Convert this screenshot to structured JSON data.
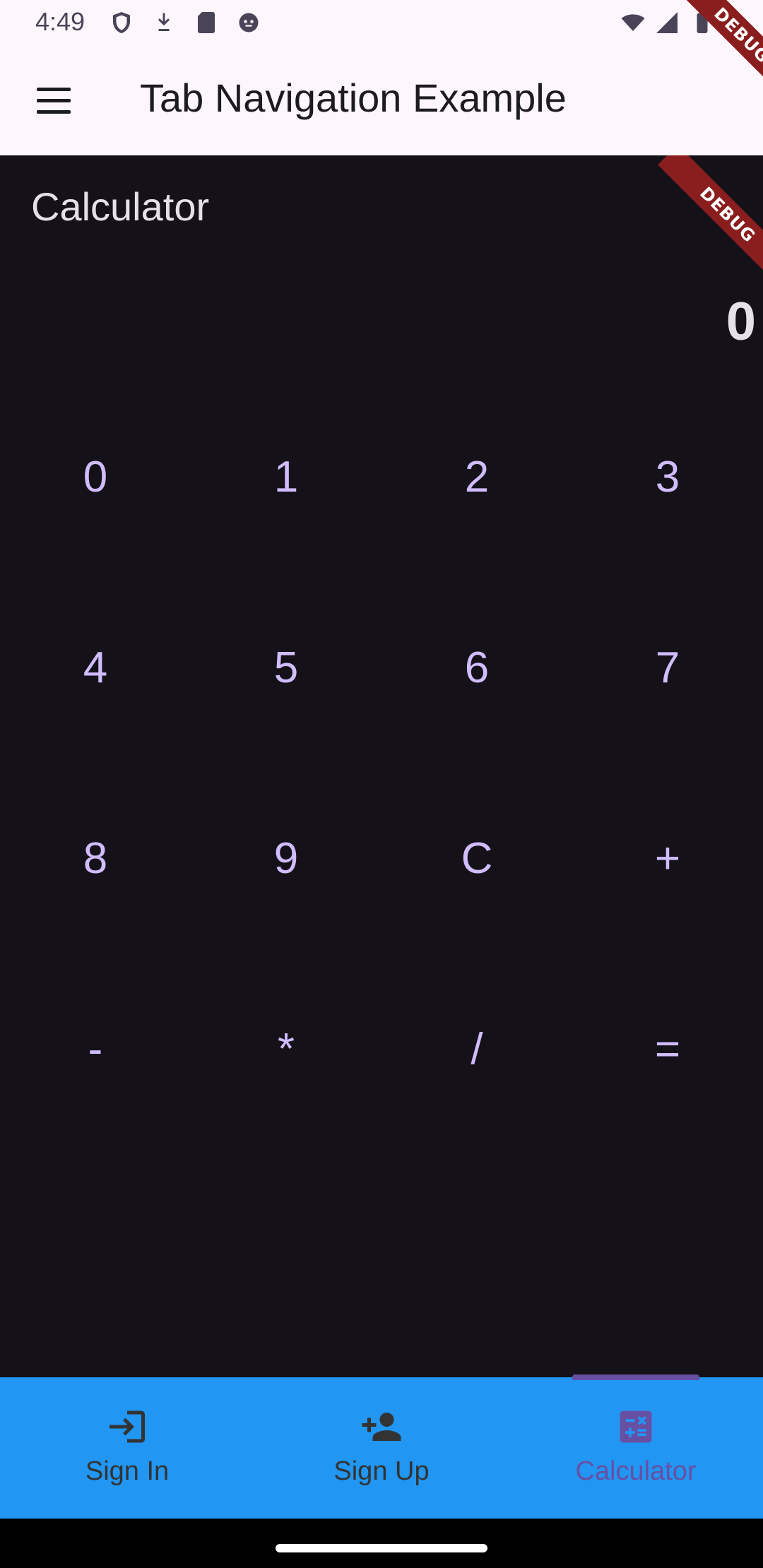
{
  "status_bar": {
    "time": "4:49",
    "icons": [
      "shield-icon",
      "download-icon",
      "sd-card-icon",
      "cat-face-icon",
      "wifi-icon",
      "signal-icon",
      "battery-icon"
    ]
  },
  "app_bar": {
    "title": "Tab Navigation Example",
    "menu_icon": "hamburger-menu-icon"
  },
  "debug_banner": "DEBUG",
  "calculator": {
    "title": "Calculator",
    "display": "0",
    "keys": [
      "0",
      "1",
      "2",
      "3",
      "4",
      "5",
      "6",
      "7",
      "8",
      "9",
      "C",
      "+",
      "-",
      "*",
      "/",
      "="
    ]
  },
  "bottom_nav": {
    "items": [
      {
        "label": "Sign In",
        "icon": "login-icon"
      },
      {
        "label": "Sign Up",
        "icon": "person-add-icon"
      },
      {
        "label": "Calculator",
        "icon": "calculator-icon"
      }
    ],
    "selected": "Calculator"
  },
  "colors": {
    "app_bar_bg": "#fdf7fd",
    "content_bg": "#141218",
    "key_text": "#d0bcff",
    "nav_bg": "#2196f3",
    "nav_active": "#6750a4",
    "debug_ribbon": "#8a1e1e"
  }
}
